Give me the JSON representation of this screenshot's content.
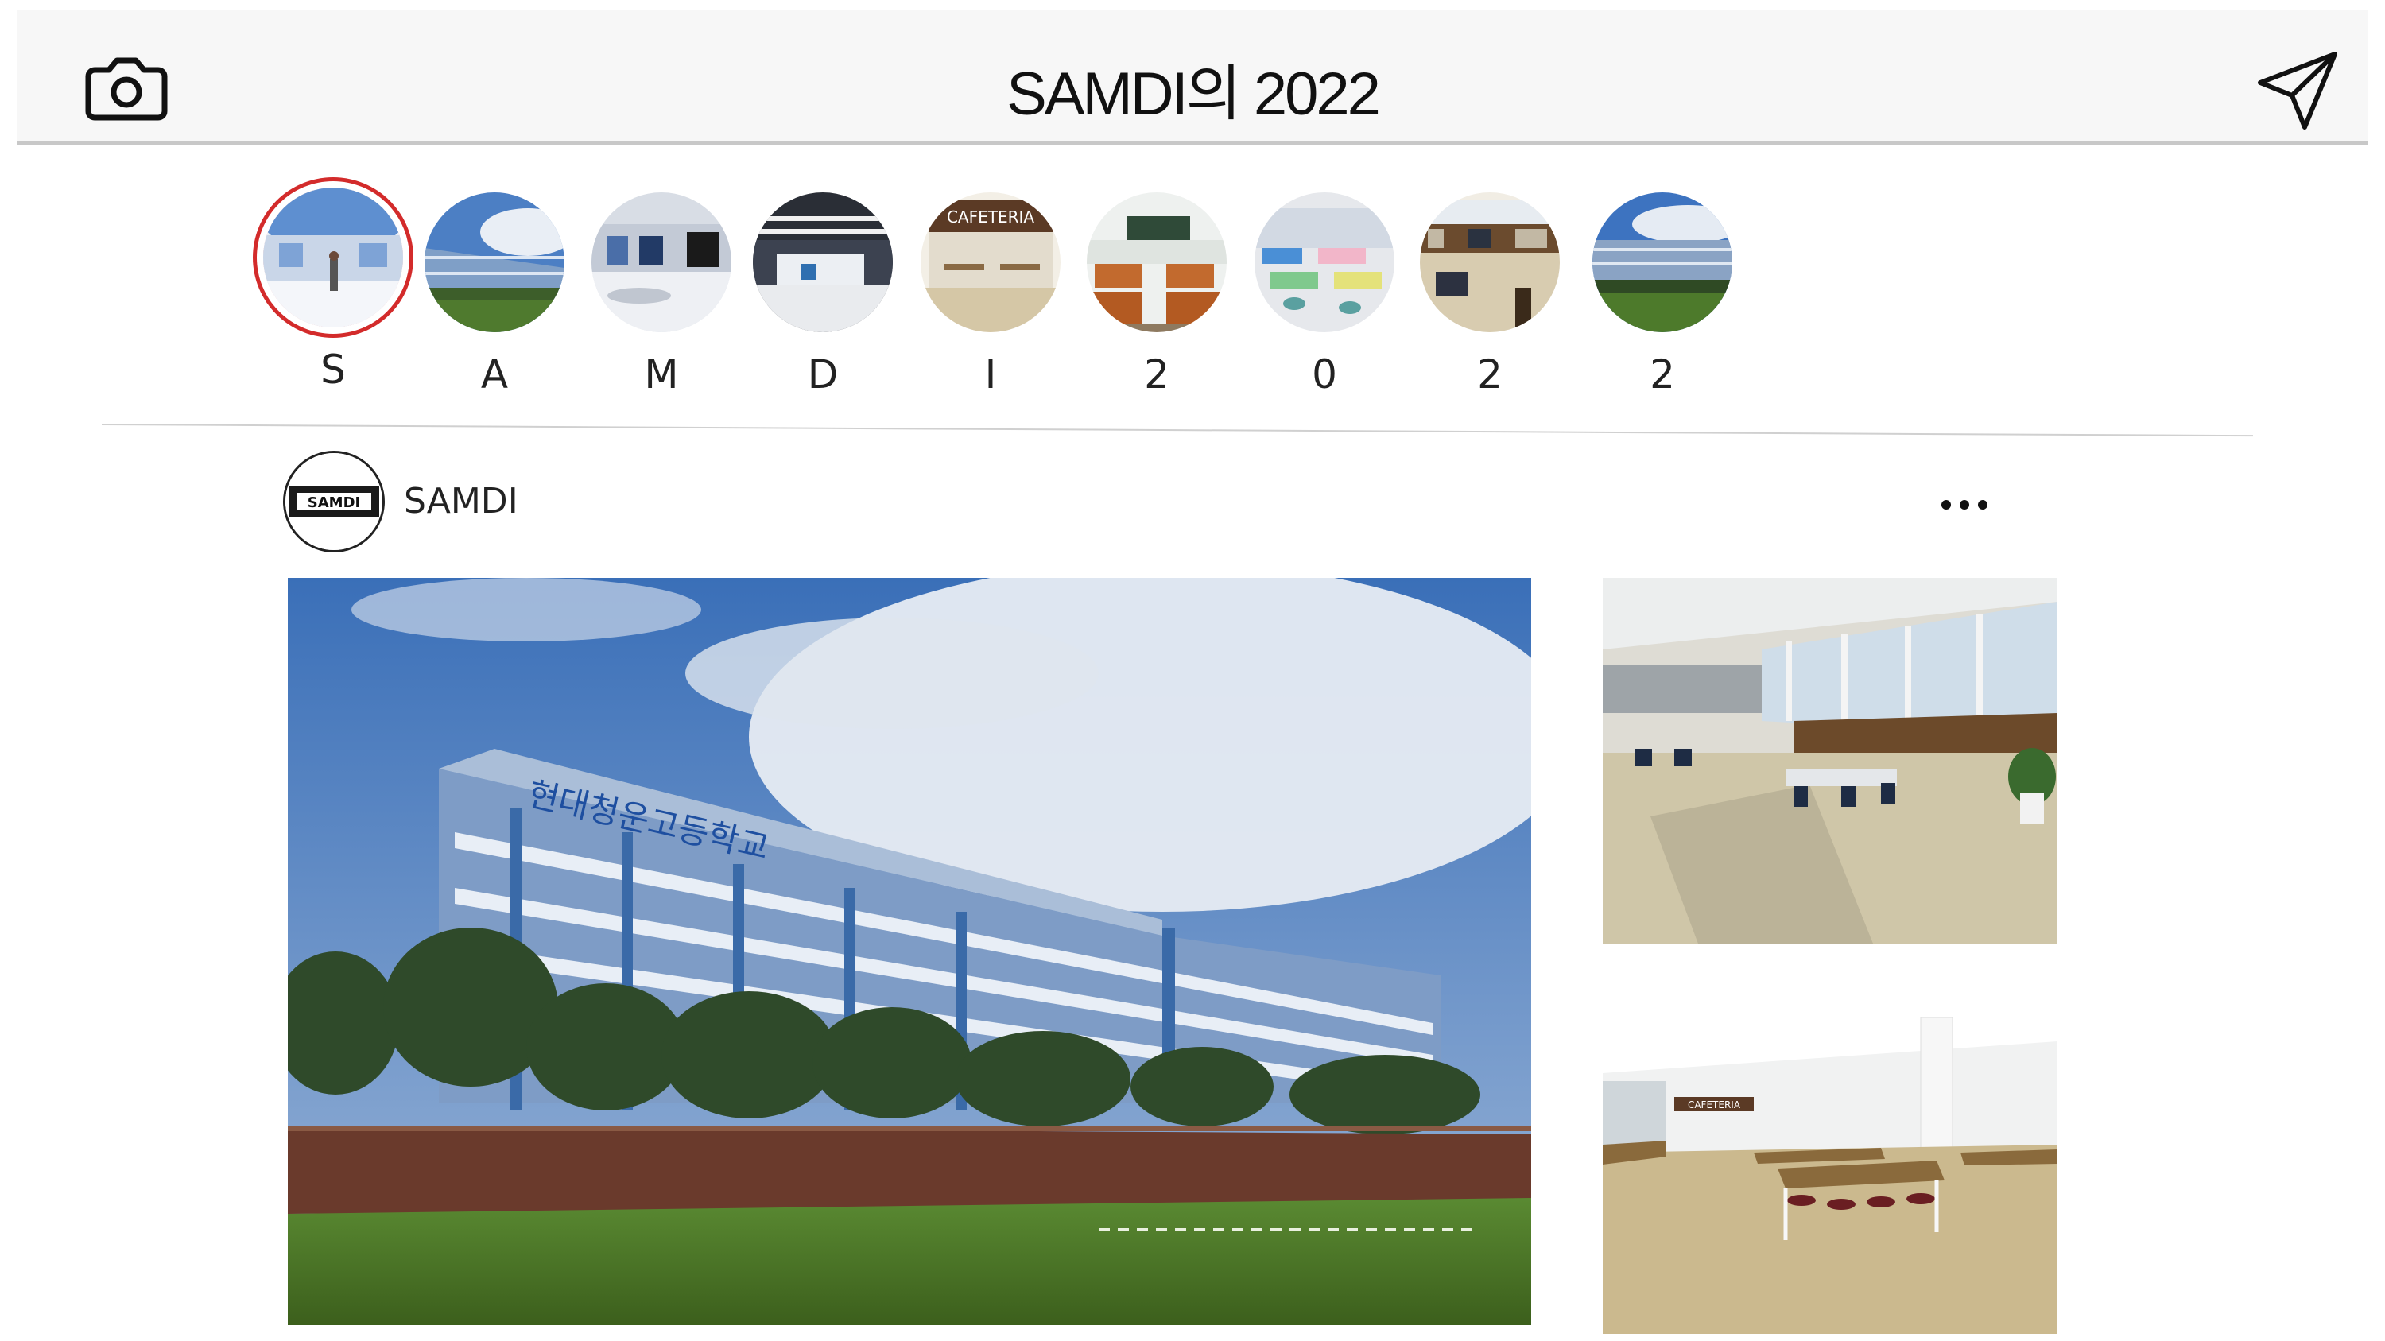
{
  "header": {
    "title": "SAMDI의 2022",
    "left_icon": "camera-icon",
    "right_icon": "send-icon"
  },
  "stories": [
    {
      "label": "S",
      "scene": "avatar-dome",
      "active": true
    },
    {
      "label": "A",
      "scene": "school-exterior"
    },
    {
      "label": "M",
      "scene": "exhibition-hall"
    },
    {
      "label": "D",
      "scene": "lab-room"
    },
    {
      "label": "I",
      "scene": "cafeteria-entrance"
    },
    {
      "label": "2",
      "scene": "classroom"
    },
    {
      "label": "0",
      "scene": "cafe-tables"
    },
    {
      "label": "2",
      "scene": "library"
    },
    {
      "label": "2",
      "scene": "school-field"
    }
  ],
  "post": {
    "username": "SAMDI",
    "avatar_text": "SAMDI",
    "more_icon": "more-horizontal-icon",
    "main_photo": {
      "scene": "school-building-exterior",
      "sign_text": "현대청운고등학교"
    },
    "side_photos": [
      {
        "scene": "library-interior"
      },
      {
        "scene": "cafeteria-interior",
        "sign_text": "CAFETERIA"
      }
    ]
  },
  "colors": {
    "active_story_ring": "#d32b2b",
    "header_bg": "#f7f7f7",
    "sky": "#3a6fb8",
    "grass": "#4a7a2a"
  }
}
